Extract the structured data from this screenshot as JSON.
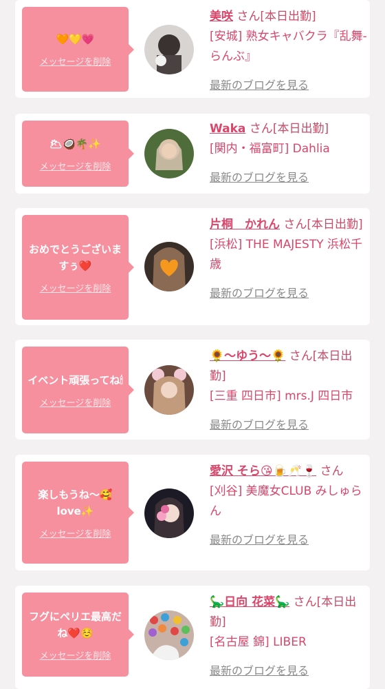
{
  "delete_label": "メッセージを削除",
  "blog_label": "最新のブログを見る",
  "san_label": "さん",
  "entries": [
    {
      "message": "🧡💛💗",
      "cast_name": "美咲",
      "status": "[本日出勤]",
      "shop": "[安城] 熟女キャバクラ『乱舞-らんぶ』"
    },
    {
      "message": "🌥🥥🌴✨",
      "cast_name": "Waka",
      "status": "[本日出勤]",
      "shop": "[関内・福富町] Dahlia"
    },
    {
      "message": "おめでとうございますぅ❤️",
      "cast_name": "片桐　かれん",
      "status": "[本日出勤]",
      "shop": "[浜松] THE MAJESTY 浜松千歳"
    },
    {
      "message": "イベント頑張ってね🕯",
      "cast_name": "🌻〜ゆう〜🌻",
      "status": "[本日出勤]",
      "shop": "[三重 四日市] mrs.J 四日市"
    },
    {
      "message": "楽しもうね〜🥰love✨",
      "cast_name": "愛沢 そら😘🍺🥂🍷",
      "status": "",
      "shop": "[刈谷] 美魔女CLUB みしゅらん"
    },
    {
      "message": "フグにペリエ最高だね❤️☺️",
      "cast_name": "🦕日向 花菜🦕",
      "status": "[本日出勤]",
      "shop": "[名古屋 錦] LIBER"
    }
  ]
}
